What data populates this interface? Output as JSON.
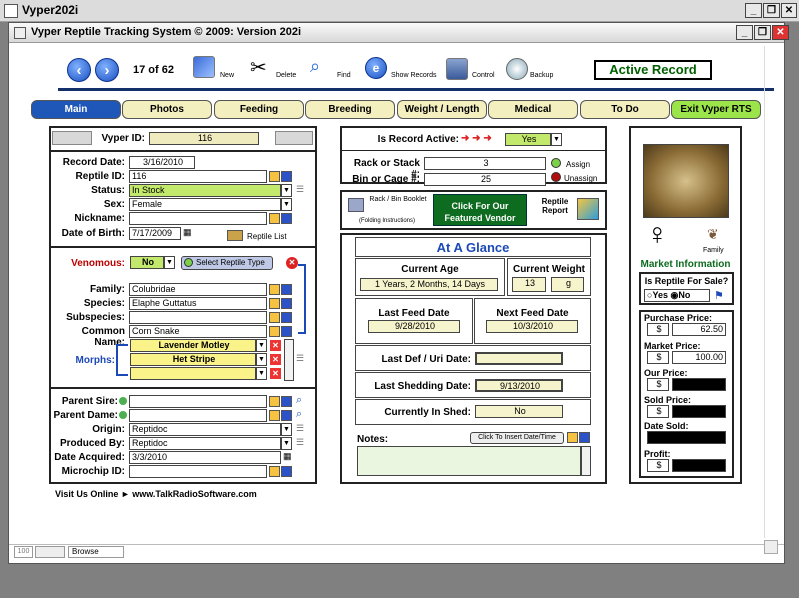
{
  "window": {
    "title": "Vyper202i",
    "app_title": "Vyper Reptile Tracking System © 2009: Version  202i"
  },
  "toolbar": {
    "record_position": "17 of 62",
    "new": "New",
    "delete": "Delete",
    "find": "Find",
    "show_records": "Show Records",
    "control": "Control",
    "backup": "Backup",
    "active_record": "Active Record"
  },
  "tabs": [
    "Main",
    "Photos",
    "Feeding",
    "Breeding",
    "Weight / Length",
    "Medical",
    "To Do",
    "Exit Vyper RTS"
  ],
  "left": {
    "vyper_id_label": "Vyper ID:",
    "vyper_id": "116",
    "record_date_label": "Record Date:",
    "record_date": "3/16/2010",
    "reptile_id_label": "Reptile ID:",
    "reptile_id": "116",
    "status_label": "Status:",
    "status": "In Stock",
    "sex_label": "Sex:",
    "sex": "Female",
    "nickname_label": "Nickname:",
    "nickname": "",
    "dob_label": "Date of Birth:",
    "dob": "7/17/2009",
    "reptile_list": "Reptile List",
    "venomous_label": "Venomous:",
    "venomous": "No",
    "select_type": "Select Reptile Type",
    "family_label": "Family:",
    "family": "Colubridae",
    "species_label": "Species:",
    "species": "Elaphe Guttatus",
    "subspecies_label": "Subspecies:",
    "subspecies": "",
    "common_label": "Common Name:",
    "common": "Corn Snake",
    "morphs_label": "Morphs:",
    "morphs": [
      "Lavender Motley",
      "Het Stripe",
      ""
    ],
    "sire_label": "Parent Sire:",
    "sire": "",
    "dame_label": "Parent Dame:",
    "dame": "",
    "origin_label": "Origin:",
    "origin": "Reptidoc",
    "produced_label": "Produced By:",
    "produced": "Reptidoc",
    "acquired_label": "Date Acquired:",
    "acquired": "3/3/2010",
    "microchip_label": "Microchip ID:",
    "microchip": ""
  },
  "visit": "Visit Us Online ► www.TalkRadioSoftware.com",
  "middle": {
    "active_label": "Is Record Active:",
    "active_arrows": "➜ ➜ ➜",
    "active": "Yes",
    "rack_label": "Rack or Stack #:",
    "rack": "3",
    "bin_label": "Bin or Cage #:",
    "bin": "25",
    "assign": "Assign",
    "unassign": "Unassign",
    "booklet": "Rack / Bin Booklet",
    "booklet_sub": "(Folding Instructions)",
    "featured": "Click For Our Featured Vendor",
    "report": "Reptile Report",
    "glance_title": "At A Glance",
    "current_age_label": "Current Age",
    "current_age": "1 Years, 2 Months, 14 Days",
    "current_weight_label": "Current Weight",
    "weight": "13",
    "weight_unit": "g",
    "last_feed_label": "Last Feed Date",
    "last_feed": "9/28/2010",
    "next_feed_label": "Next Feed Date",
    "next_feed": "10/3/2010",
    "last_def_label": "Last Def / Uri Date:",
    "last_def": "",
    "last_shed_label": "Last Shedding Date:",
    "last_shed": "9/13/2010",
    "in_shed_label": "Currently In Shed:",
    "in_shed": "No",
    "notes_label": "Notes:",
    "insert_date": "Click To Insert Date/Time"
  },
  "right": {
    "sex_symbol": "♀",
    "family": "Family",
    "market_title": "Market Information",
    "for_sale_label": "Is Reptile For Sale?",
    "yes": "Yes",
    "no": "No",
    "purchase_label": "Purchase Price:",
    "purchase": "62.50",
    "market_label": "Market Price:",
    "market": "100.00",
    "our_label": "Our Price:",
    "sold_label": "Sold Price:",
    "date_sold_label": "Date Sold:",
    "profit_label": "Profit:",
    "currency": "$"
  },
  "statusbar": {
    "zoom": "100",
    "mode": "Browse"
  }
}
